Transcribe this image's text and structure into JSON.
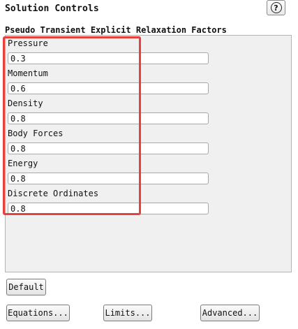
{
  "panel": {
    "title": "Solution Controls",
    "help_icon": "question-circle-icon",
    "help_symbol": "?"
  },
  "group": {
    "label": "Pseudo Transient Explicit Relaxation Factors",
    "highlight_color": "#e5413d",
    "fields": [
      {
        "label": "Pressure",
        "value": "0.3"
      },
      {
        "label": "Momentum",
        "value": "0.6"
      },
      {
        "label": "Density",
        "value": "0.8"
      },
      {
        "label": "Body Forces",
        "value": "0.8"
      },
      {
        "label": "Energy",
        "value": "0.8"
      },
      {
        "label": "Discrete Ordinates",
        "value": "0.8"
      }
    ]
  },
  "buttons": {
    "default": "Default",
    "equations": "Equations...",
    "limits": "Limits...",
    "advanced": "Advanced..."
  }
}
